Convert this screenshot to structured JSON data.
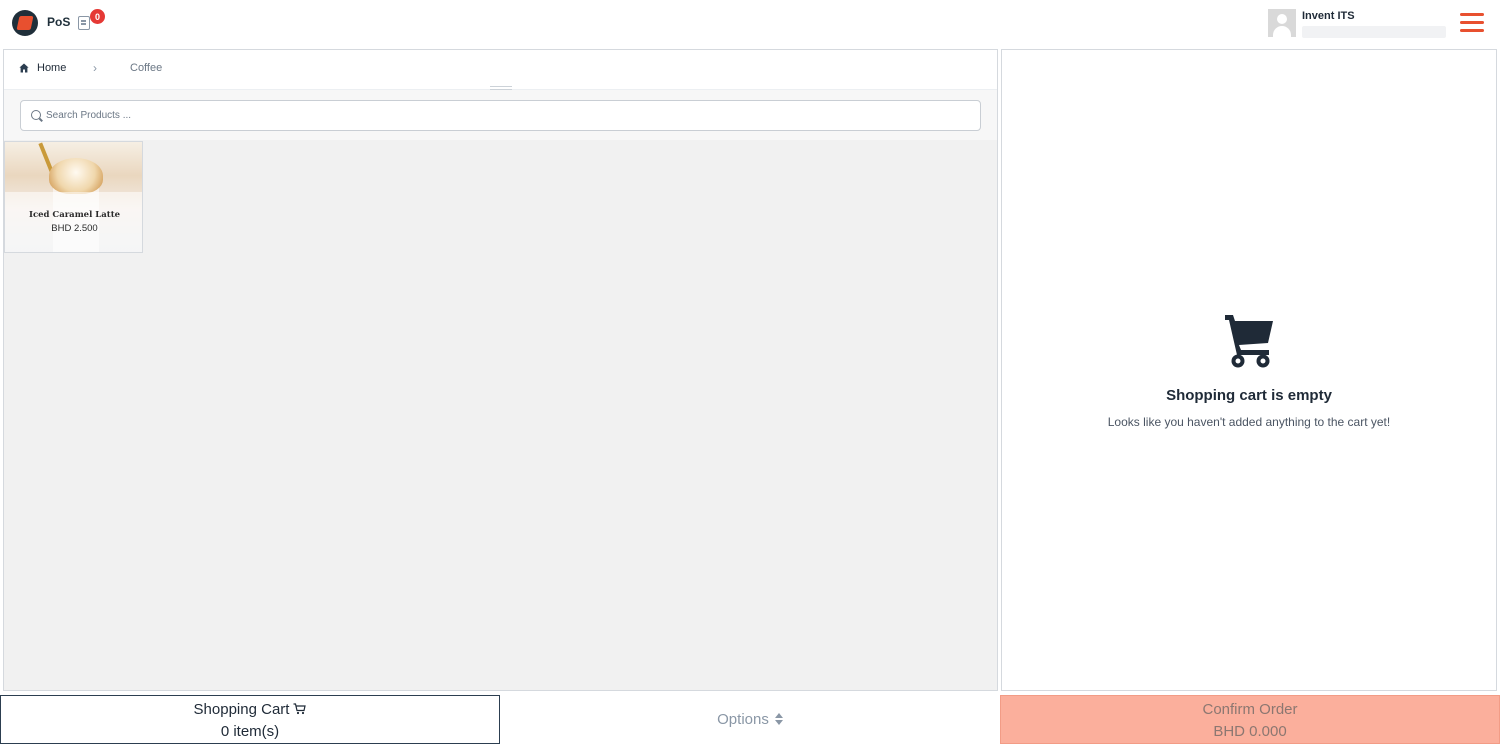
{
  "header": {
    "app_name": "PoS",
    "orders_badge": "0",
    "user_name": "Invent ITS"
  },
  "breadcrumb": {
    "home": "Home",
    "current": "Coffee"
  },
  "search": {
    "placeholder": "Search Products ...",
    "value": ""
  },
  "products": [
    {
      "name": "Iced Caramel Latte",
      "price": "BHD 2.500"
    }
  ],
  "cart": {
    "empty_title": "Shopping cart is empty",
    "empty_message": "Looks like you haven't added anything to the cart yet!"
  },
  "footer": {
    "cart_label": "Shopping Cart",
    "cart_count": "0 item(s)",
    "options_label": "Options",
    "confirm_label": "Confirm Order",
    "confirm_total": "BHD 0.000"
  },
  "colors": {
    "accent": "#e8502f",
    "badge": "#e53935",
    "confirm_bg": "#fbaf9c",
    "dark": "#1f2f3a"
  },
  "icons": [
    "logo-icon",
    "orders-icon",
    "avatar-icon",
    "hamburger-menu-icon",
    "home-icon",
    "chevron-right-icon",
    "search-icon",
    "shopping-cart-icon",
    "sort-icon"
  ]
}
